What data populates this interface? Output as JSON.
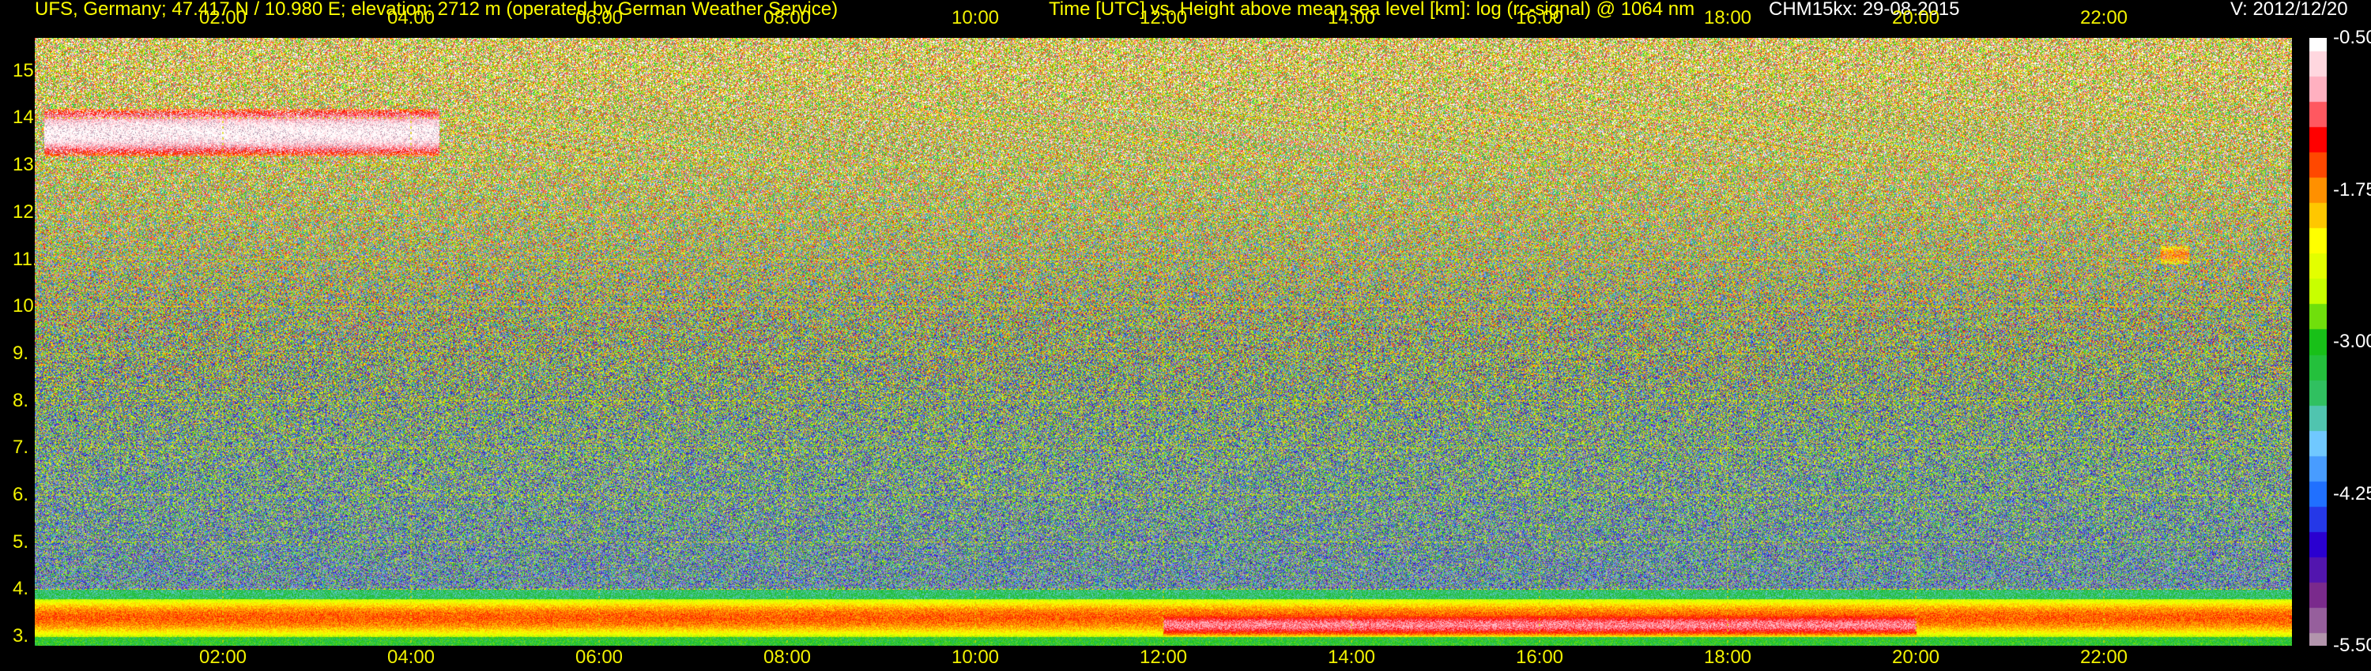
{
  "header": {
    "site": "UFS, Germany; 47.417 N / 10.980 E; elevation: 2712 m  (operated by German Weather Service)",
    "axes_title": "Time [UTC] vs. Height above mean sea level [km]: log (rc-signal) @ 1064 nm",
    "instrument": "CHM15kx: 29-08-2015",
    "version": "V: 2012/12/20"
  },
  "colors": {
    "header_site": "#ffff00",
    "header_title": "#ffff00",
    "header_instrument": "#ffffff",
    "header_version": "#ffffff",
    "ticks": "#f2f200",
    "grid": "#d8d800"
  },
  "chart_data": {
    "type": "heatmap",
    "title": "Time [UTC] vs. Height above mean sea level [km]: log (rc-signal) @ 1064 nm",
    "xlabel": "Time [UTC]",
    "ylabel": "Height above mean sea level [km]",
    "x_ticks": [
      "02:00",
      "04:00",
      "06:00",
      "08:00",
      "10:00",
      "12:00",
      "14:00",
      "16:00",
      "18:00",
      "20:00",
      "22:00"
    ],
    "x_tick_hours": [
      2,
      4,
      6,
      8,
      10,
      12,
      14,
      16,
      18,
      20,
      22
    ],
    "xlim_hours": [
      0,
      24
    ],
    "y_ticks": [
      "3.",
      "4.",
      "5.",
      "6.",
      "7.",
      "8.",
      "9.",
      "10.",
      "11.",
      "12.",
      "13.",
      "14.",
      "15."
    ],
    "y_tick_values": [
      3,
      4,
      5,
      6,
      7,
      8,
      9,
      10,
      11,
      12,
      13,
      14,
      15
    ],
    "ylim_km": [
      2.8,
      15.7
    ],
    "grid": true,
    "colorbar": {
      "ticks": [
        "-0.50",
        "-1.75",
        "-3.00",
        "-4.25",
        "-5.50"
      ],
      "tick_values": [
        -0.5,
        -1.75,
        -3.0,
        -4.25,
        -5.5
      ],
      "range": [
        -5.5,
        -0.5
      ],
      "scale": [
        "#b294ac",
        "#7a2a8c",
        "#2a00d0",
        "#2070ff",
        "#70c8ff",
        "#30c060",
        "#18c018",
        "#c8ff00",
        "#ffff00",
        "#ff9000",
        "#ff0000",
        "#ffb0c0",
        "#ffffff"
      ]
    },
    "features": [
      {
        "name": "cirrus cloud",
        "time_hours": [
          0.1,
          4.3
        ],
        "height_km": [
          13.2,
          14.2
        ],
        "level": -0.5
      },
      {
        "name": "cirrus",
        "time_hours": [
          22.6,
          22.9
        ],
        "height_km": [
          10.9,
          11.3
        ],
        "level": -1.8
      },
      {
        "name": "boundary layer",
        "time_hours": [
          0,
          24
        ],
        "height_km": [
          3.0,
          3.8
        ],
        "level": -1.6
      },
      {
        "name": "aerosol layer",
        "time_hours": [
          12.0,
          20.0
        ],
        "height_km": [
          3.0,
          3.5
        ],
        "level": -1.0
      }
    ]
  }
}
